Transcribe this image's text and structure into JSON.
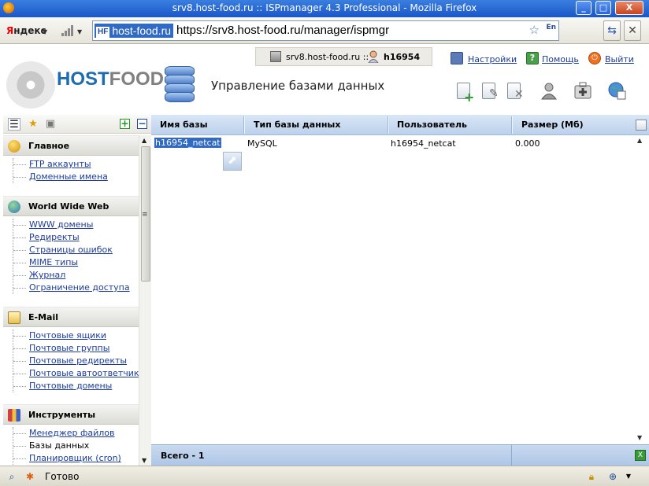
{
  "window": {
    "title": "srv8.host-food.ru :: ISPmanager 4.3 Professional - Mozilla Firefox",
    "minimize": "_",
    "maximize": "□",
    "close": "X"
  },
  "navbar": {
    "yandex_first": "Я",
    "yandex_rest": "ндекс",
    "site_id_badge": "HF",
    "site_id_label": "host-food.ru",
    "url": "https://srv8.host-food.ru/manager/ispmgr",
    "lang": "En"
  },
  "header": {
    "server": "srv8.host-food.ru ::",
    "user": "h16954",
    "links": {
      "settings": "Настройки",
      "help": "Помощь",
      "logout": "Выйти"
    },
    "logo_host": "HOST",
    "logo_food": "FOOD",
    "page_title": "Управление базами данных"
  },
  "sidebar": {
    "sections": [
      {
        "title": "Главное",
        "items": [
          "FTP аккаунты",
          "Доменные имена"
        ]
      },
      {
        "title": "World Wide Web",
        "items": [
          "WWW домены",
          "Редиректы",
          "Страницы ошибок",
          "MIME типы",
          "Журнал",
          "Ограничение доступа"
        ]
      },
      {
        "title": "E-Mail",
        "items": [
          "Почтовые ящики",
          "Почтовые группы",
          "Почтовые редиректы",
          "Почтовые автоответчики",
          "Почтовые домены"
        ]
      },
      {
        "title": "Инструменты",
        "items": [
          "Менеджер файлов",
          "Базы данных",
          "Планировщик (cron)"
        ]
      }
    ]
  },
  "table": {
    "columns": [
      "Имя базы",
      "Тип базы данных",
      "Пользователь",
      "Размер (Мб)"
    ],
    "rows": [
      [
        "h16954_netcat",
        "MySQL",
        "h16954_netcat",
        "0.000"
      ]
    ],
    "footer": "Всего - 1"
  },
  "status": {
    "text": "Готово"
  },
  "colors": {
    "selection": "#316ac5",
    "grid_header": "#bdd1ec",
    "link": "#1c3c9c",
    "logo_host": "#1e6cb0",
    "logo_food": "#808080"
  }
}
